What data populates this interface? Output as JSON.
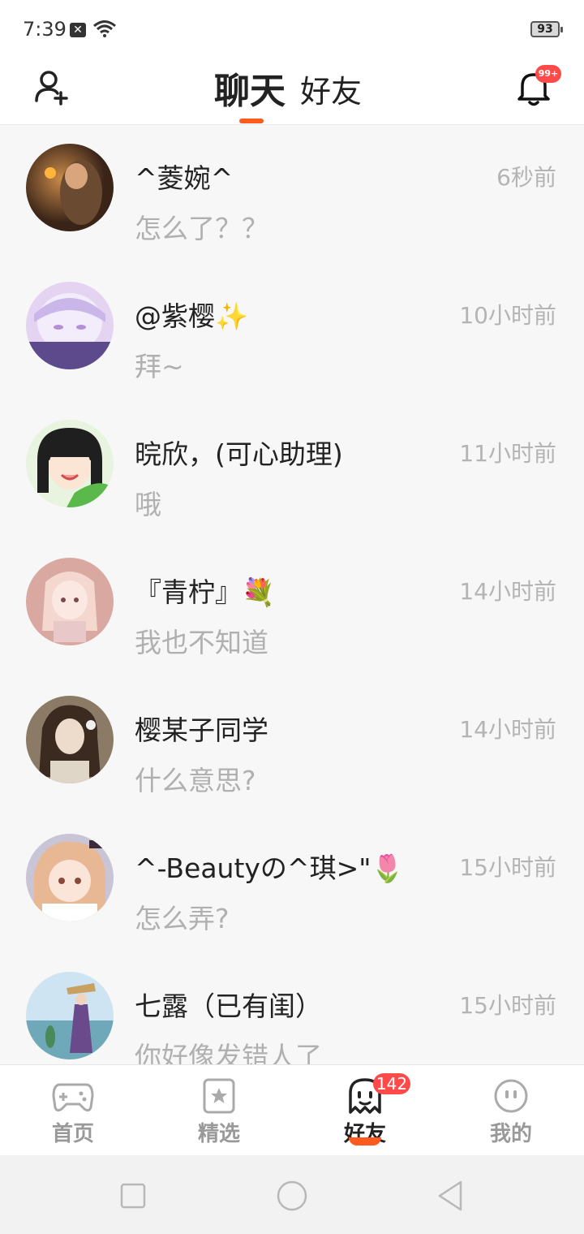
{
  "status_bar": {
    "time": "7:39",
    "notification_icon": "close-box-icon",
    "battery": "93"
  },
  "header": {
    "tab_chat": "聊天",
    "tab_friends": "好友",
    "bell_badge": "99+",
    "accent_color": "#ff5a1f"
  },
  "chats": [
    {
      "name": "^菱婉^",
      "time": "6秒前",
      "preview": "怎么了？？"
    },
    {
      "name": "@紫樱✨",
      "time": "10小时前",
      "preview": "拜~"
    },
    {
      "name": "晥欣，(可心助理)",
      "time": "11小时前",
      "preview": "哦"
    },
    {
      "name": "『青柠』💐",
      "time": "14小时前",
      "preview": "我也不知道"
    },
    {
      "name": "樱某子同学",
      "time": "14小时前",
      "preview": "什么意思?"
    },
    {
      "name": "^-Beautyの^琪>\"🌷",
      "time": "15小时前",
      "preview": "怎么弄?"
    },
    {
      "name": "七露（已有闺）",
      "time": "15小时前",
      "preview": "你好像发错人了"
    }
  ],
  "bottom_nav": {
    "home": "首页",
    "featured": "精选",
    "friends": "好友",
    "mine": "我的",
    "friends_badge": "142"
  }
}
